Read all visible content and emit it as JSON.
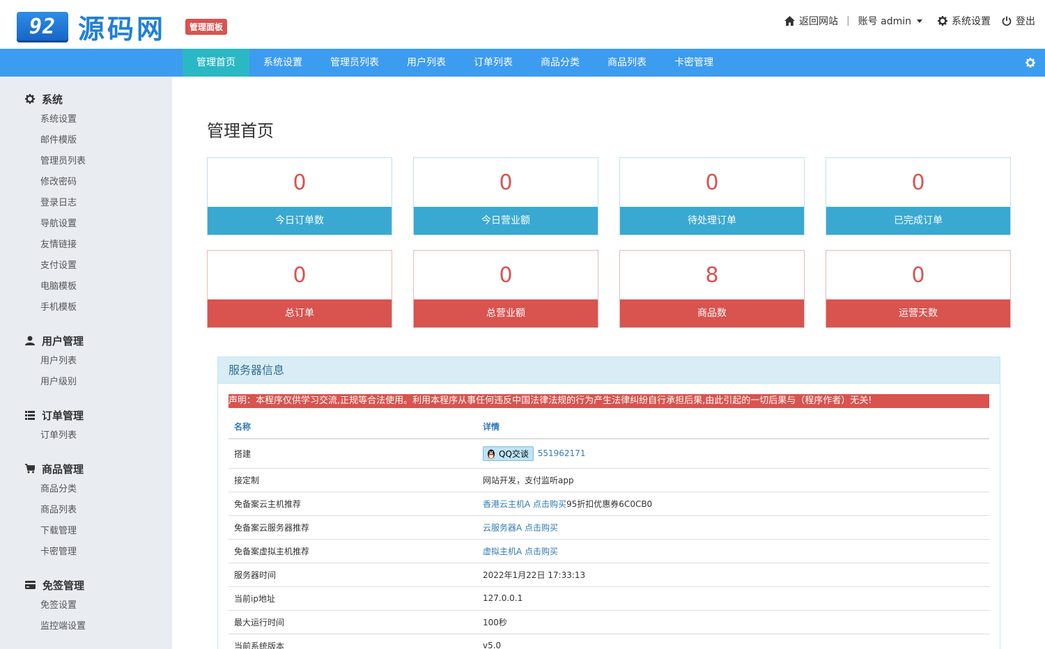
{
  "header": {
    "logo_box": "92",
    "logo_text": "源码网",
    "badge": "管理面板",
    "links": {
      "home": "返回网站",
      "separator": "|",
      "account": "账号 admin",
      "settings": "系统设置",
      "logout": "登出"
    }
  },
  "nav": {
    "items": [
      "管理首页",
      "系统设置",
      "管理员列表",
      "用户列表",
      "订单列表",
      "商品分类",
      "商品列表",
      "卡密管理"
    ],
    "active": 0
  },
  "sidebar": {
    "groups": [
      {
        "title": "系统",
        "icon": "gear-icon",
        "items": [
          "系统设置",
          "邮件模版",
          "管理员列表",
          "修改密码",
          "登录日志",
          "导航设置",
          "友情链接",
          "支付设置",
          "电脑模板",
          "手机模板"
        ]
      },
      {
        "title": "用户管理",
        "icon": "user-icon",
        "items": [
          "用户列表",
          "用户级别"
        ]
      },
      {
        "title": "订单管理",
        "icon": "list-icon",
        "items": [
          "订单列表"
        ]
      },
      {
        "title": "商品管理",
        "icon": "cart-icon",
        "items": [
          "商品分类",
          "商品列表",
          "下载管理",
          "卡密管理"
        ]
      },
      {
        "title": "免签管理",
        "icon": "credit-card-icon",
        "items": [
          "免签设置",
          "监控端设置"
        ]
      }
    ]
  },
  "main": {
    "title": "管理首页",
    "stats": [
      {
        "value": "0",
        "label": "今日订单数",
        "color": "#39a9d2"
      },
      {
        "value": "0",
        "label": "今日营业额",
        "color": "#39a9d2"
      },
      {
        "value": "0",
        "label": "待处理订单",
        "color": "#39a9d2"
      },
      {
        "value": "0",
        "label": "已完成订单",
        "color": "#39a9d2"
      },
      {
        "value": "0",
        "label": "总订单",
        "color": "#d9534f"
      },
      {
        "value": "0",
        "label": "总营业额",
        "color": "#d9534f"
      },
      {
        "value": "8",
        "label": "商品数",
        "color": "#d9534f"
      },
      {
        "value": "0",
        "label": "运营天数",
        "color": "#d9534f"
      }
    ],
    "panel": {
      "title": "服务器信息",
      "notice": "声明：本程序仅供学习交流,正规等合法使用。利用本程序从事任何违反中国法律法规的行为产生法律纠纷自行承担后果,由此引起的一切后果与（程序作者）无关!",
      "columns": [
        "名称",
        "详情"
      ],
      "rows": {
        "r0": {
          "name": "搭建",
          "qq_button": "QQ交谈",
          "qq_number": "551962171"
        },
        "r1": {
          "name": "接定制",
          "detail": "网站开发，支付监听app"
        },
        "r2": {
          "name": "免备案云主机推荐",
          "link": "香港云主机A 点击购买",
          "detail": "95折扣优惠券6C0CB0"
        },
        "r3": {
          "name": "免备案云服务器推荐",
          "link": "云服务器A 点击购买"
        },
        "r4": {
          "name": "免备案虚拟主机推荐",
          "link": "虚拟主机A 点击购买"
        },
        "r5": {
          "name": "服务器时间",
          "detail": "2022年1月22日 17:33:13"
        },
        "r6": {
          "name": "当前ip地址",
          "detail": "127.0.0.1"
        },
        "r7": {
          "name": "最大运行时间",
          "detail": "100秒"
        },
        "r8": {
          "name": "当前系统版本",
          "detail": "v5.0"
        }
      }
    }
  },
  "colors": {
    "nav": "#3c9cf0",
    "nav_active": "#2ab8c4",
    "blue_card": "#39a9d2",
    "red_card": "#d9534f",
    "sidebar_bg": "#e9edf2"
  }
}
